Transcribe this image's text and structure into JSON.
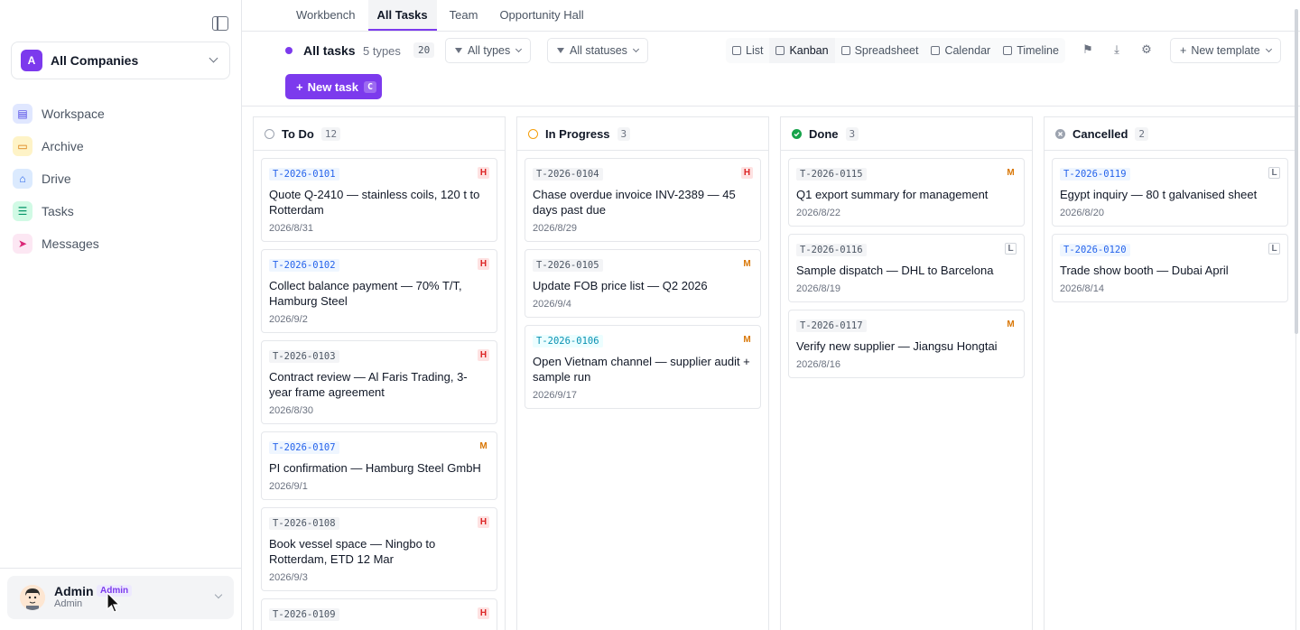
{
  "sidebar": {
    "company": {
      "initial": "A",
      "name": "All Companies"
    },
    "items": [
      {
        "label": "Workspace",
        "icon": "document-icon",
        "color": "#4f46e5",
        "bg": "#e0e7ff"
      },
      {
        "label": "Archive",
        "icon": "folder-icon",
        "color": "#d97706",
        "bg": "#fef3c7"
      },
      {
        "label": "Drive",
        "icon": "drive-icon",
        "color": "#2563eb",
        "bg": "#dbeafe"
      },
      {
        "label": "Tasks",
        "icon": "list-icon",
        "color": "#059669",
        "bg": "#d1fae5"
      },
      {
        "label": "Messages",
        "icon": "send-icon",
        "color": "#db2777",
        "bg": "#fce7f3"
      }
    ],
    "user": {
      "name": "Admin",
      "badge": "Admin",
      "role": "Admin"
    }
  },
  "tabs": [
    "Workbench",
    "All Tasks",
    "Team",
    "Opportunity Hall"
  ],
  "active_tab": "All Tasks",
  "toolbar": {
    "title": "All tasks",
    "types": "5 types",
    "count": "20",
    "filter_types": "All types",
    "filter_statuses": "All statuses",
    "views": [
      "List",
      "Kanban",
      "Spreadsheet",
      "Calendar",
      "Timeline"
    ],
    "active_view": "Kanban",
    "template": "New template",
    "new_task": "New task",
    "new_task_key": "C"
  },
  "columns": [
    {
      "title": "To Do",
      "count": "12",
      "color": "#9ca3af",
      "cards": [
        {
          "id": "T-2026-0101",
          "priority": "H",
          "title": "Quote Q-2410 — stainless coils, 120 t to Rotterdam",
          "date": "2026/8/31"
        },
        {
          "id": "T-2026-0102",
          "priority": "H",
          "title": "Collect balance payment — 70% T/T, Hamburg Steel",
          "date": "2026/9/2"
        },
        {
          "id": "T-2026-0103",
          "priority": "H",
          "title": "Contract review — Al Faris Trading, 3-year frame agreement",
          "date": "2026/8/30"
        },
        {
          "id": "T-2026-0107",
          "priority": "M",
          "title": "PI confirmation — Hamburg Steel GmbH",
          "date": "2026/9/1"
        },
        {
          "id": "T-2026-0108",
          "priority": "H",
          "title": "Book vessel space — Ningbo to Rotterdam, ETD 12 Mar",
          "date": "2026/9/3"
        },
        {
          "id": "T-2026-0109",
          "priority": "H",
          "title": "",
          "date": ""
        }
      ]
    },
    {
      "title": "In Progress",
      "count": "3",
      "color": "#f59e0b",
      "cards": [
        {
          "id": "T-2026-0104",
          "priority": "H",
          "title": "Chase overdue invoice INV-2389 — 45 days past due",
          "date": "2026/8/29"
        },
        {
          "id": "T-2026-0105",
          "priority": "M",
          "title": "Update FOB price list — Q2 2026",
          "date": "2026/9/4"
        },
        {
          "id": "T-2026-0106",
          "priority": "M",
          "title": "Open Vietnam channel — supplier audit + sample run",
          "date": "2026/9/17"
        }
      ]
    },
    {
      "title": "Done",
      "count": "3",
      "color": "#16a34a",
      "cards": [
        {
          "id": "T-2026-0115",
          "priority": "M",
          "title": "Q1 export summary for management",
          "date": "2026/8/22"
        },
        {
          "id": "T-2026-0116",
          "priority": "L",
          "title": "Sample dispatch — DHL to Barcelona",
          "date": "2026/8/19"
        },
        {
          "id": "T-2026-0117",
          "priority": "M",
          "title": "Verify new supplier — Jiangsu Hongtai",
          "date": "2026/8/16"
        }
      ]
    },
    {
      "title": "Cancelled",
      "count": "2",
      "color": "#9ca3af",
      "cards": [
        {
          "id": "T-2026-0119",
          "priority": "L",
          "title": "Egypt inquiry — 80 t galvanised sheet",
          "date": "2026/8/20"
        },
        {
          "id": "T-2026-0120",
          "priority": "L",
          "title": "Trade show booth — Dubai April",
          "date": "2026/8/14"
        }
      ]
    }
  ]
}
